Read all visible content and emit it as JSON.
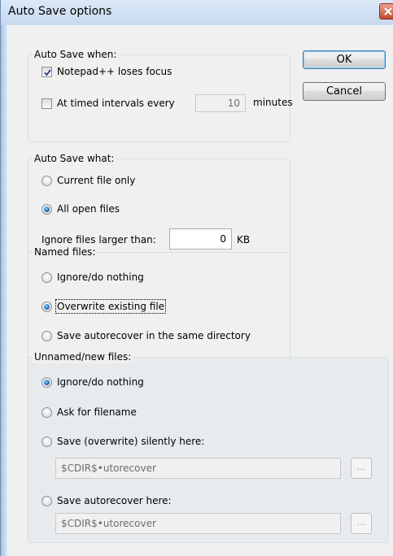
{
  "window": {
    "title": "Auto Save options"
  },
  "buttons": {
    "ok": "OK",
    "cancel": "Cancel"
  },
  "when_group": {
    "label": "Auto Save when:",
    "loses_focus_label": "Notepad++ loses focus",
    "loses_focus_checked": true,
    "timed_label": "At timed intervals every",
    "timed_checked": false,
    "interval_value": "10",
    "interval_unit": "minutes"
  },
  "what_group": {
    "label": "Auto Save what:",
    "options": [
      "Current file only",
      "All open files"
    ],
    "selected": "All open files",
    "ignore_label": "Ignore files larger than:",
    "ignore_value": "0",
    "ignore_unit": "KB"
  },
  "named_group": {
    "label": "Named files:",
    "options": [
      "Ignore/do nothing",
      "Overwrite existing file",
      "Save autorecover in the same directory"
    ],
    "selected": "Overwrite existing file"
  },
  "unnamed_group": {
    "label": "Unnamed/new files:",
    "options": [
      "Ignore/do nothing",
      "Ask for filename",
      "Save (overwrite) silently here:",
      "Save autorecover here:"
    ],
    "selected": "Ignore/do nothing",
    "silent_path": "$CDIR$•utorecover",
    "autorecover_path": "$CDIR$•utorecover",
    "browse_label": "..."
  },
  "colors": {
    "title_bar": "#c7d9ef",
    "dialog_bg": "#f0f0f0",
    "close_button": "#c64a2f",
    "radio_selected": "#1a5fb4"
  }
}
